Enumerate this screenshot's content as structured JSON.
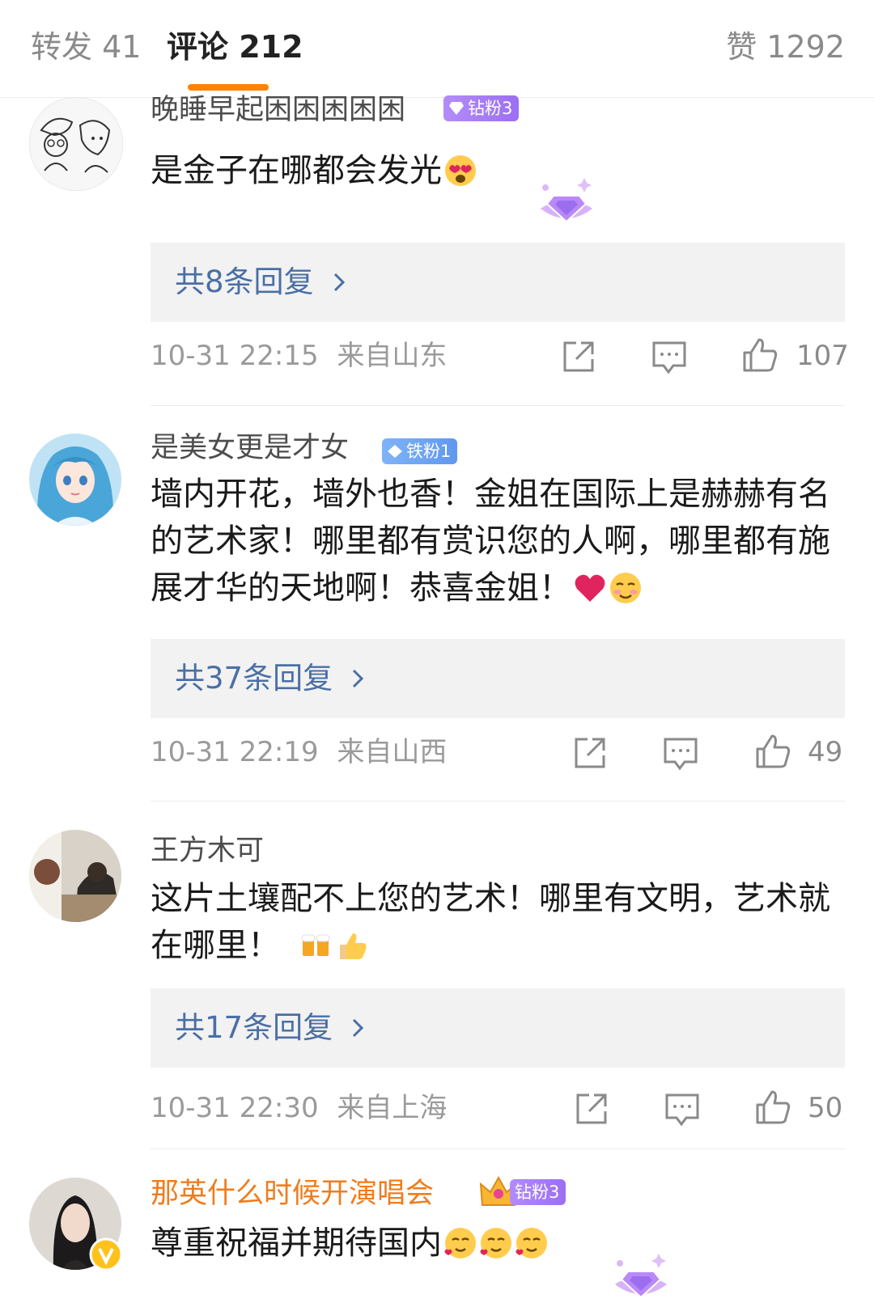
{
  "tabs": {
    "repost": "转发 41",
    "comments": "评论 212",
    "likes": "赞 1292"
  },
  "colors": {
    "accent": "#ff8200",
    "reply_link": "#4a6fa5",
    "vip_name": "#f07c1c",
    "badge_purple": "#a77cf7",
    "badge_blue": "#6fa3f5"
  },
  "comments": [
    {
      "user": "晚睡早起困困困困困",
      "badge": "钻粉3",
      "text": "是金子在哪都会发光",
      "emojis": [
        "heart-eyes-face"
      ],
      "replies": "共8条回复",
      "time": "10-31 22:15",
      "location": "来自山东",
      "likes": "107"
    },
    {
      "user": "是美女更是才女",
      "badge": "铁粉1",
      "text": "墙内开花，墙外也香！金姐在国际上是赫赫有名的艺术家！哪里都有赏识您的人啊，哪里都有施展才华的天地啊！恭喜金姐！",
      "emojis": [
        "red-heart",
        "blushing-face"
      ],
      "replies": "共37条回复",
      "time": "10-31 22:19",
      "location": "来自山西",
      "likes": "49"
    },
    {
      "user": "王方木可",
      "badge": "",
      "text": "这片土壤配不上您的艺术！哪里有文明，艺术就在哪里！",
      "emojis": [
        "beer-mugs",
        "thumbs-up"
      ],
      "replies": "共17条回复",
      "time": "10-31 22:30",
      "location": "来自上海",
      "likes": "50"
    },
    {
      "user": "那英什么时候开演唱会",
      "badge": "钻粉3",
      "text": "尊重祝福并期待国内",
      "emojis": [
        "smiling-hearts-face",
        "smiling-hearts-face",
        "smiling-hearts-face"
      ]
    }
  ]
}
